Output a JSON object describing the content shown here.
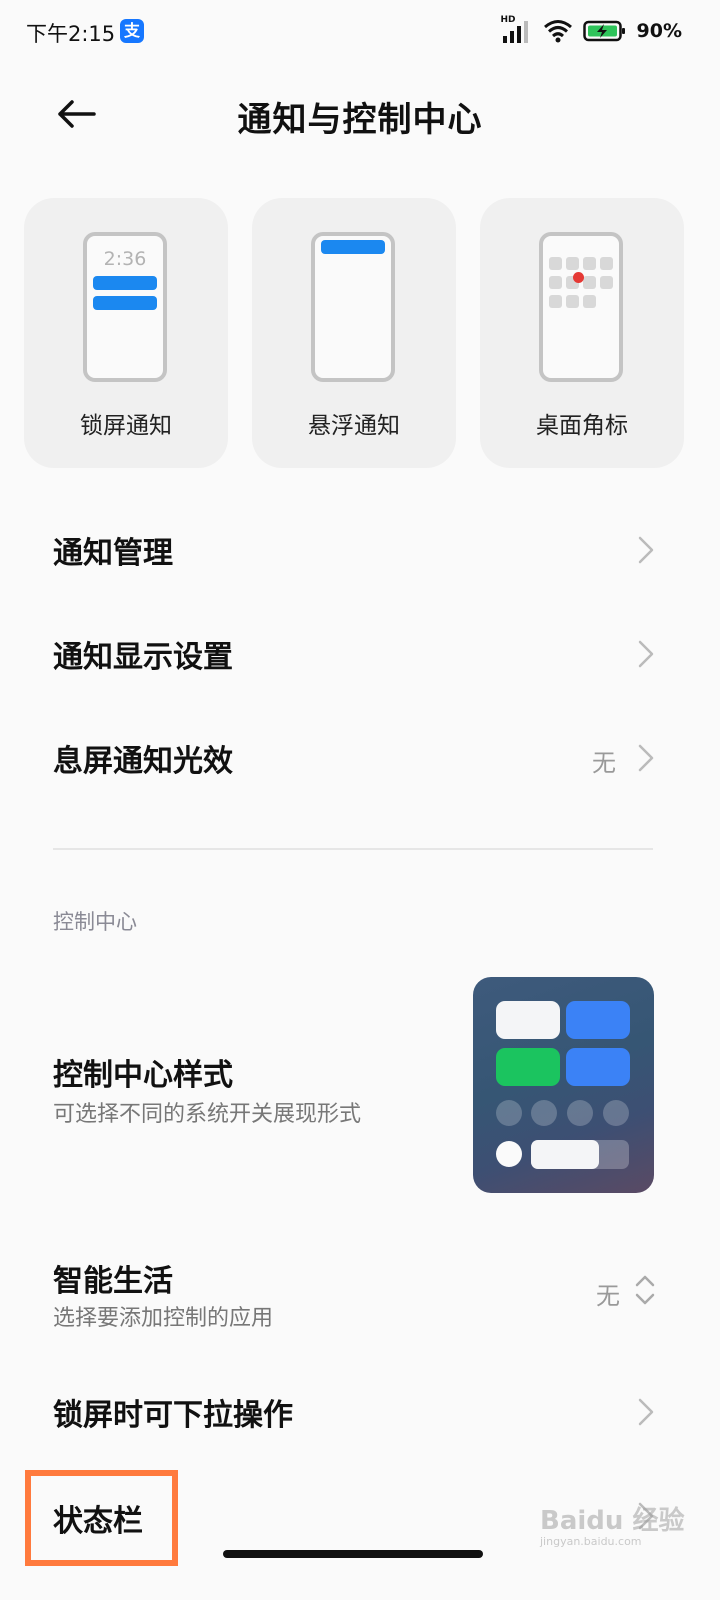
{
  "status_bar": {
    "time": "下午2:15",
    "alipay_glyph": "支",
    "hd_label": "HD",
    "battery_percent": "90%"
  },
  "header": {
    "title": "通知与控制中心",
    "back_icon": "arrow-left-icon"
  },
  "cards": [
    {
      "label": "锁屏通知",
      "preview_time": "2:36",
      "icon": "lockscreen-notification-icon"
    },
    {
      "label": "悬浮通知",
      "icon": "floating-notification-icon"
    },
    {
      "label": "桌面角标",
      "icon": "desktop-badge-icon"
    }
  ],
  "rows": {
    "notification_management": {
      "title": "通知管理"
    },
    "notification_display": {
      "title": "通知显示设置"
    },
    "screen_off_light": {
      "title": "息屏通知光效",
      "value": "无"
    },
    "control_center_section": "控制中心",
    "control_center_style": {
      "title": "控制中心样式",
      "subtitle": "可选择不同的系统开关展现形式"
    },
    "smart_life": {
      "title": "智能生活",
      "subtitle": "选择要添加控制的应用",
      "value": "无"
    },
    "lockscreen_pulldown": {
      "title": "锁屏时可下拉操作"
    },
    "status_bar": {
      "title": "状态栏"
    }
  },
  "watermark": {
    "text": "Baidu 经验",
    "sub": "jingyan.baidu.com"
  },
  "colors": {
    "accent_blue": "#1b88f0",
    "highlight_orange": "#ff7a3d",
    "cc_green": "#1bc45f",
    "cc_blue": "#3b82f6"
  }
}
